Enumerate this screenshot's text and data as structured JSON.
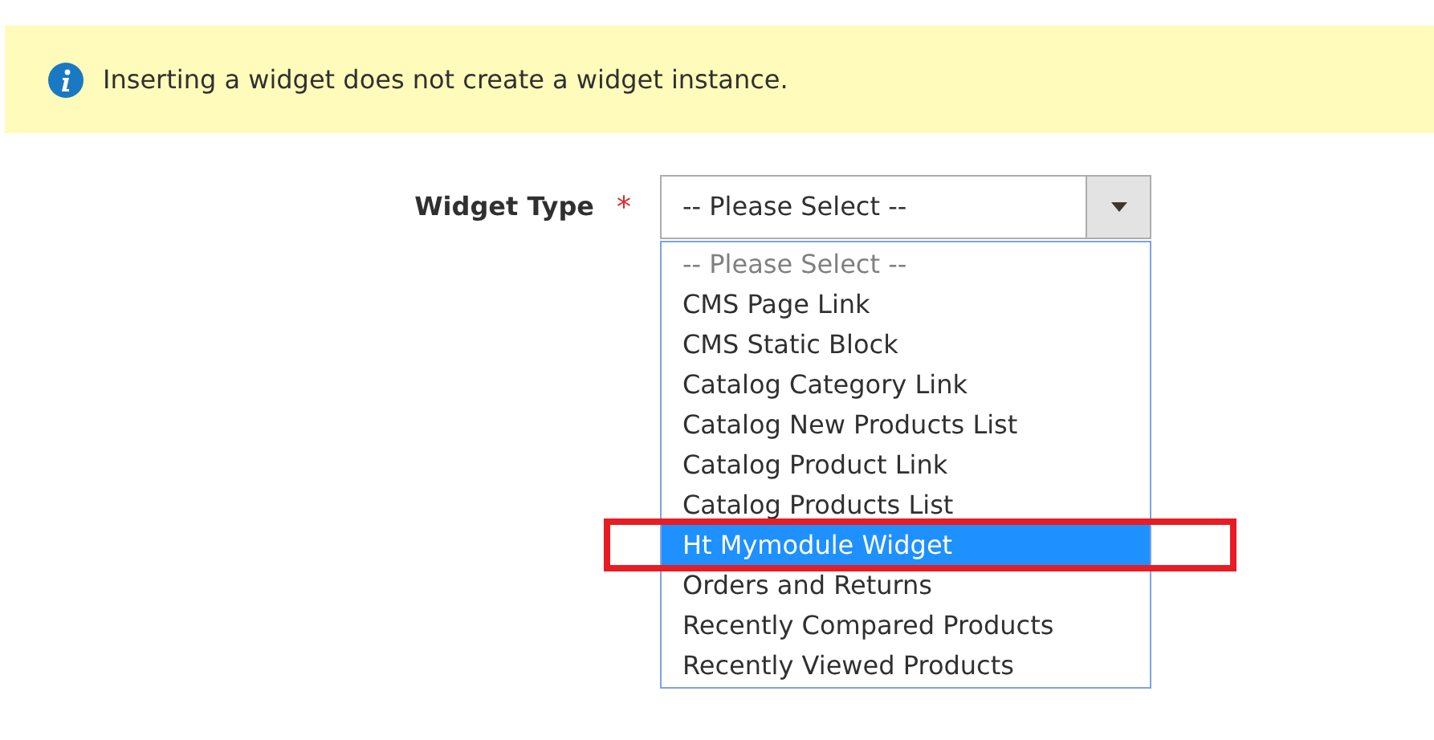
{
  "notice": {
    "message": "Inserting a widget does not create a widget instance."
  },
  "field": {
    "label": "Widget Type",
    "required_mark": "*",
    "value": "-- Please Select --"
  },
  "options": [
    {
      "label": "-- Please Select --",
      "kind": "placeholder",
      "selected": false
    },
    {
      "label": "CMS Page Link",
      "kind": "option",
      "selected": false
    },
    {
      "label": "CMS Static Block",
      "kind": "option",
      "selected": false
    },
    {
      "label": "Catalog Category Link",
      "kind": "option",
      "selected": false
    },
    {
      "label": "Catalog New Products List",
      "kind": "option",
      "selected": false
    },
    {
      "label": "Catalog Product Link",
      "kind": "option",
      "selected": false
    },
    {
      "label": "Catalog Products List",
      "kind": "option",
      "selected": false
    },
    {
      "label": "Ht Mymodule Widget",
      "kind": "option",
      "selected": true
    },
    {
      "label": "Orders and Returns",
      "kind": "option",
      "selected": false
    },
    {
      "label": "Recently Compared Products",
      "kind": "option",
      "selected": false
    },
    {
      "label": "Recently Viewed Products",
      "kind": "option",
      "selected": false
    }
  ]
}
